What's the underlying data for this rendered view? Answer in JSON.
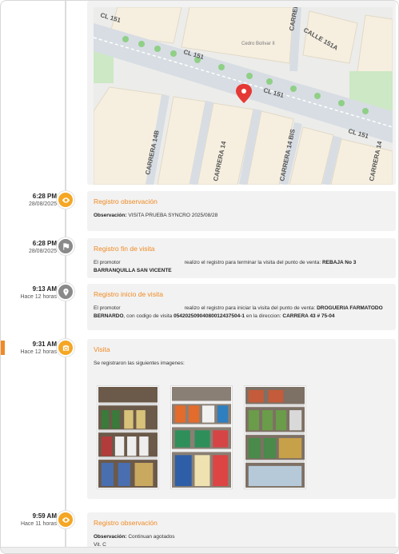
{
  "map": {
    "street_labels": [
      "CL 151",
      "CL 151",
      "CL 151",
      "CL 151",
      "CALLE 151A",
      "CARRERA",
      "CARRERA 14B",
      "CARRERA 14",
      "CARRERA 14 BIS",
      "CARRERA 14"
    ],
    "poi": "Cedro Bolívar II"
  },
  "events": [
    {
      "time": "6:28 PM",
      "date": "28/08/2025",
      "icon": "eye-icon",
      "title": "Registro observación",
      "label": "Observación:",
      "text": "VISITA PRUEBA SYNCRO 2025/08/28"
    },
    {
      "time": "6:28 PM",
      "date": "28/08/2025",
      "icon": "flag-icon",
      "title": "Registro fin de visita",
      "p1": "El promotor",
      "p2": "realizo el registro para terminar la visita del punto de venta:",
      "store": "REBAJA No 3 BARRANQUILLA SAN VICENTE"
    },
    {
      "time": "9:13 AM",
      "date": "Hace 12 horas",
      "icon": "location-pin-icon",
      "title": "Registro inicio de visita",
      "p1": "El promotor",
      "p2": "realizo el registro para iniciar la visita del punto de venta:",
      "store": "DROGUERIA FARMATODO BERNARDO",
      "p3": ", con codigo de visita",
      "code": "05420250904080012437504-1",
      "p4": "en la direccion:",
      "address": "CARRERA 43 # 75-04"
    },
    {
      "time": "9:31 AM",
      "date": "Hace 12 horas",
      "icon": "camera-icon",
      "title": "Visita",
      "text": "Se registraron las siguientes imagenes:"
    },
    {
      "time": "9:59 AM",
      "date": "Hace 11 horas",
      "icon": "eye-icon",
      "title": "Registro observación",
      "label": "Observación:",
      "text": "Continuan agotados",
      "extra": "Vit. C"
    }
  ],
  "colors": {
    "accent": "#f08a24",
    "icon_orange": "#f5a623",
    "icon_gray": "#8a8a8a",
    "card_bg": "#f2f2f2"
  }
}
